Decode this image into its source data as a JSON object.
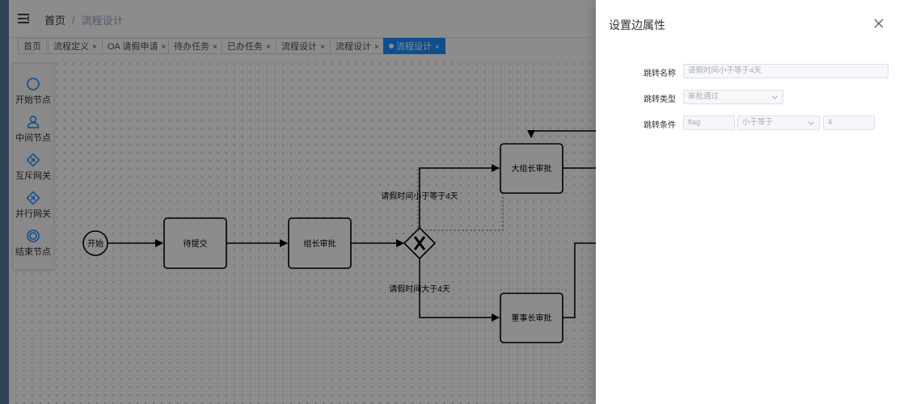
{
  "navbar": {
    "breadcrumb": {
      "home": "首页",
      "separator": "/",
      "current": "流程设计"
    }
  },
  "tags": [
    {
      "label": "首页",
      "closable": false
    },
    {
      "label": "流程定义",
      "closable": true
    },
    {
      "label": "OA 请假申请",
      "closable": true
    },
    {
      "label": "待办任务",
      "closable": true
    },
    {
      "label": "已办任务",
      "closable": true
    },
    {
      "label": "流程设计",
      "closable": true
    },
    {
      "label": "流程设计",
      "closable": true
    },
    {
      "label": "流程设计",
      "closable": true,
      "active": true
    }
  ],
  "tag_close_glyph": "×",
  "palette": [
    {
      "label": "开始节点",
      "icon": "start-circle-icon"
    },
    {
      "label": "中间节点",
      "icon": "user-task-icon"
    },
    {
      "label": "互斥网关",
      "icon": "exclusive-gateway-icon"
    },
    {
      "label": "并行网关",
      "icon": "parallel-gateway-icon"
    },
    {
      "label": "结束节点",
      "icon": "end-circle-icon"
    }
  ],
  "diagram": {
    "start": "开始",
    "tasks": {
      "submit": "待提交",
      "group_leader": "组长审批",
      "big_group_leader": "大组长审批",
      "director": "董事长审批"
    },
    "edges": {
      "le4": "请假时间小于等于4天",
      "gt4": "请假时间大于4天"
    }
  },
  "drawer": {
    "title": "设置边属性",
    "fields": {
      "name": {
        "label": "跳转名称",
        "placeholder": "请假时间小于等于4天"
      },
      "type": {
        "label": "跳转类型",
        "value": "审批通过"
      },
      "condition": {
        "label": "跳转条件",
        "variable": "flag",
        "operator": "小于等于",
        "value": "4"
      }
    }
  },
  "colors": {
    "active_tag": "#1890ff",
    "palette_icon": "#1890ff",
    "overlay": "rgba(0,0,0,0.45)"
  }
}
